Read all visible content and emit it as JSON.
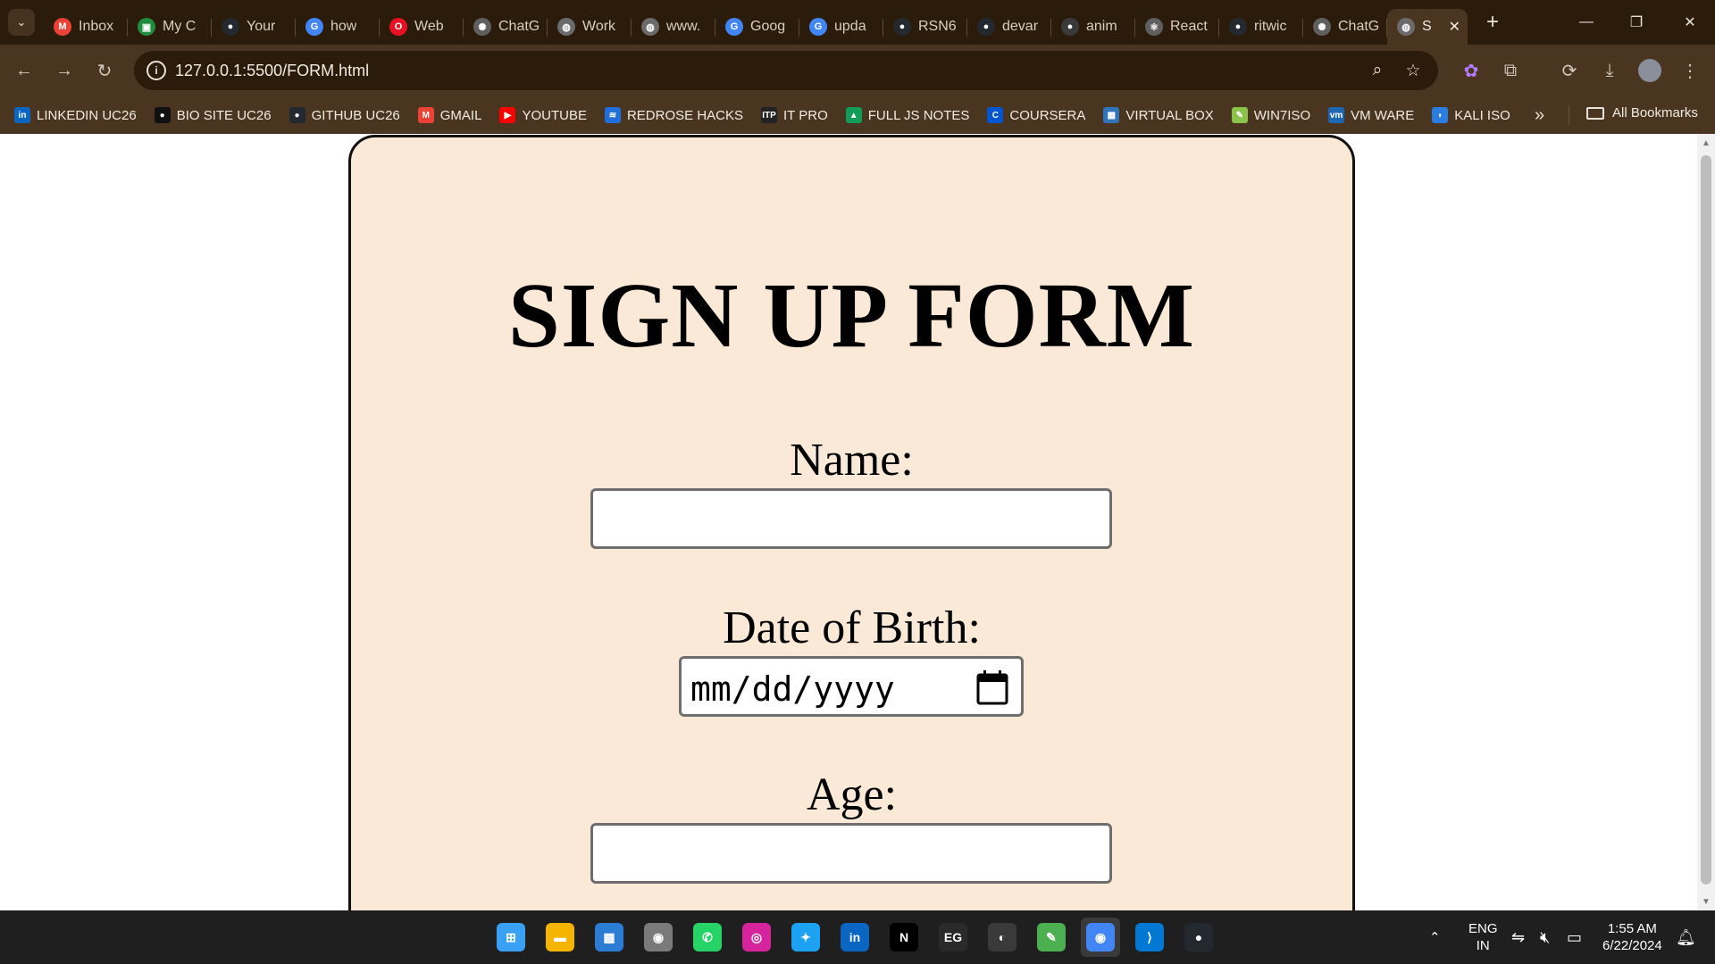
{
  "browser": {
    "tabs": [
      {
        "title": "Inbox",
        "icon": "gmail-icon",
        "color": "#ea4335",
        "glyph": "M"
      },
      {
        "title": "My C",
        "icon": "classroom-icon",
        "color": "#1e8e3e",
        "glyph": "▣"
      },
      {
        "title": "Your",
        "icon": "github-icon",
        "color": "#24292f",
        "glyph": "●"
      },
      {
        "title": "how",
        "icon": "google-icon",
        "color": "#4285f4",
        "glyph": "G"
      },
      {
        "title": "Web",
        "icon": "opera-icon",
        "color": "#e81123",
        "glyph": "O"
      },
      {
        "title": "ChatG",
        "icon": "chatgpt-icon",
        "color": "#5f5f5f",
        "glyph": "✺"
      },
      {
        "title": "Work",
        "icon": "globe-icon",
        "color": "#6b6b6b",
        "glyph": "◍"
      },
      {
        "title": "www.",
        "icon": "globe-icon",
        "color": "#6b6b6b",
        "glyph": "◍"
      },
      {
        "title": "Goog",
        "icon": "google-icon",
        "color": "#4285f4",
        "glyph": "G"
      },
      {
        "title": "upda",
        "icon": "google-icon",
        "color": "#4285f4",
        "glyph": "G"
      },
      {
        "title": "RSN6",
        "icon": "github-icon",
        "color": "#24292f",
        "glyph": "●"
      },
      {
        "title": "devar",
        "icon": "github-icon",
        "color": "#24292f",
        "glyph": "●"
      },
      {
        "title": "anim",
        "icon": "github-icon",
        "color": "#3a3a3a",
        "glyph": "●"
      },
      {
        "title": "React",
        "icon": "react-icon",
        "color": "#5f5f5f",
        "glyph": "⚛"
      },
      {
        "title": "ritwic",
        "icon": "github-icon",
        "color": "#24292f",
        "glyph": "●"
      },
      {
        "title": "ChatG",
        "icon": "chatgpt-icon",
        "color": "#5f5f5f",
        "glyph": "✺"
      },
      {
        "title": "S",
        "icon": "globe-icon",
        "color": "#6b6b6b",
        "glyph": "◍",
        "active": true
      }
    ],
    "url": "127.0.0.1:5500/FORM.html",
    "bookmarks": [
      {
        "label": "LINKEDIN UC26",
        "icon": "linkedin-icon",
        "color": "#0a66c2",
        "glyph": "in"
      },
      {
        "label": "BIO SITE UC26",
        "icon": "biosite-icon",
        "color": "#111111",
        "glyph": "●"
      },
      {
        "label": "GITHUB UC26",
        "icon": "github-icon",
        "color": "#24292f",
        "glyph": "●"
      },
      {
        "label": "GMAIL",
        "icon": "gmail-icon",
        "color": "#ea4335",
        "glyph": "M"
      },
      {
        "label": "YOUTUBE",
        "icon": "youtube-icon",
        "color": "#ff0000",
        "glyph": "▶"
      },
      {
        "label": "REDROSE HACKS",
        "icon": "redrose-icon",
        "color": "#1e6fd9",
        "glyph": "≋"
      },
      {
        "label": "IT PRO",
        "icon": "itpro-icon",
        "color": "#222222",
        "glyph": "ITP"
      },
      {
        "label": "FULL JS NOTES",
        "icon": "google-drive-icon",
        "color": "#0f9d58",
        "glyph": "▲"
      },
      {
        "label": "COURSERA",
        "icon": "coursera-icon",
        "color": "#0056d2",
        "glyph": "C"
      },
      {
        "label": "VIRTUAL BOX",
        "icon": "virtualbox-icon",
        "color": "#2f73b8",
        "glyph": "▦"
      },
      {
        "label": "WIN7ISO",
        "icon": "win7iso-icon",
        "color": "#8bc34a",
        "glyph": "✎"
      },
      {
        "label": "VM WARE",
        "icon": "vmware-icon",
        "color": "#1d66b3",
        "glyph": "vm"
      },
      {
        "label": "KALI ISO",
        "icon": "kali-icon",
        "color": "#2a7de1",
        "glyph": "◗"
      }
    ],
    "all_bookmarks_label": "All Bookmarks"
  },
  "page": {
    "title": "SIGN UP FORM",
    "fields": [
      {
        "label": "Name:",
        "type": "text",
        "value": ""
      },
      {
        "label": "Date of Birth:",
        "type": "date",
        "placeholder": "mm/dd/yyyy"
      },
      {
        "label": "Age:",
        "type": "text",
        "value": ""
      }
    ],
    "colors": {
      "card_background": "#fbe9d7",
      "card_border": "#111111"
    }
  },
  "taskbar": {
    "apps": [
      {
        "name": "start-icon",
        "color": "#3aa0f3",
        "glyph": "⊞"
      },
      {
        "name": "file-explorer-icon",
        "color": "#f4b400",
        "glyph": "▬"
      },
      {
        "name": "microsoft-store-icon",
        "color": "#2b7cd3",
        "glyph": "▦"
      },
      {
        "name": "camera-icon",
        "color": "#7a7a7a",
        "glyph": "◉"
      },
      {
        "name": "whatsapp-icon",
        "color": "#25d366",
        "glyph": "✆"
      },
      {
        "name": "instagram-icon",
        "color": "#d6249f",
        "glyph": "◎"
      },
      {
        "name": "twitter-icon",
        "color": "#1da1f2",
        "glyph": "✦"
      },
      {
        "name": "linkedin-icon",
        "color": "#0a66c2",
        "glyph": "in"
      },
      {
        "name": "netflix-icon",
        "color": "#000000",
        "glyph": "N"
      },
      {
        "name": "epic-games-icon",
        "color": "#2a2a2a",
        "glyph": "EG"
      },
      {
        "name": "obs-icon",
        "color": "#3a3a3a",
        "glyph": "◐"
      },
      {
        "name": "notepad-icon",
        "color": "#4caf50",
        "glyph": "✎"
      },
      {
        "name": "chrome-icon",
        "color": "#4285f4",
        "glyph": "◉",
        "active": true
      },
      {
        "name": "vscode-icon",
        "color": "#0078d4",
        "glyph": "⟩"
      },
      {
        "name": "github-icon",
        "color": "#24292f",
        "glyph": "●"
      }
    ],
    "language": "ENG",
    "region": "IN",
    "time": "1:55 AM",
    "date": "6/22/2024"
  }
}
